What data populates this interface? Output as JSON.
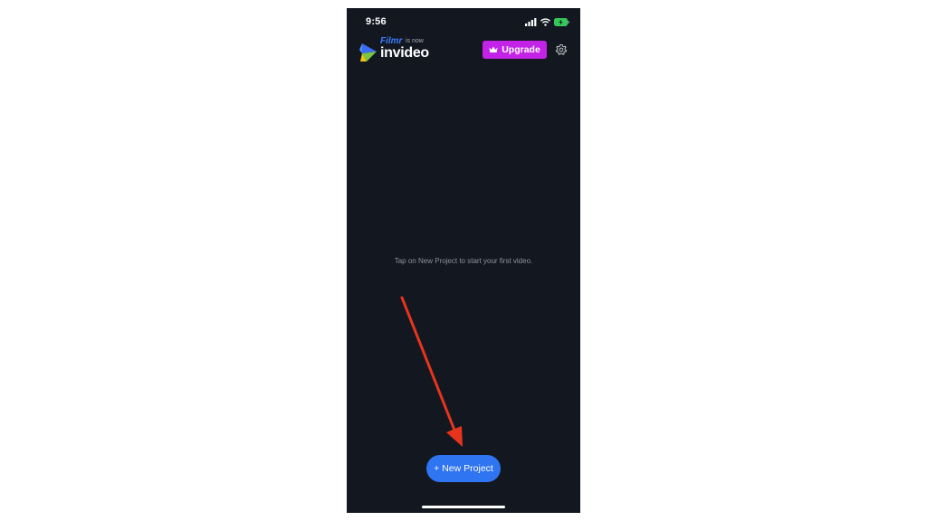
{
  "status_bar": {
    "time": "9:56"
  },
  "header": {
    "brand_filmr": "Filmr",
    "brand_is_now": "is now",
    "brand_name": "invideo",
    "upgrade_label": "Upgrade",
    "settings_icon": "gear-icon"
  },
  "empty_state": {
    "message": "Tap on New Project to start your first video."
  },
  "actions": {
    "new_project_label": "+ New Project"
  },
  "colors": {
    "background": "#131820",
    "upgrade": "#c223e6",
    "new_project": "#2f74f0",
    "annotation_arrow": "#e8341c"
  }
}
